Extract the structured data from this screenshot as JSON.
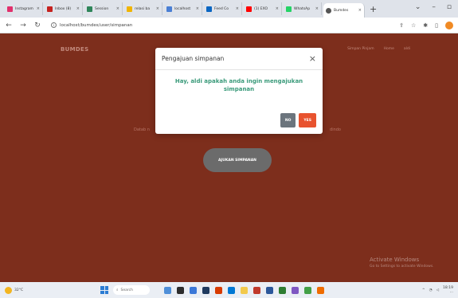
{
  "browser": {
    "tabs": [
      {
        "label": "Instagram",
        "color": "#e1306c"
      },
      {
        "label": "Inbox (8)",
        "color": "#c5221f"
      },
      {
        "label": "Session",
        "color": "#2f855a"
      },
      {
        "label": "relasi ba",
        "color": "#f0b400"
      },
      {
        "label": "localhost",
        "color": "#4a7fd4"
      },
      {
        "label": "Feed Co",
        "color": "#0a66c2"
      },
      {
        "label": "(1) EXO",
        "color": "#ff0000"
      },
      {
        "label": "WhatsAp",
        "color": "#25d366"
      },
      {
        "label": "Bumdes",
        "color": "#555555"
      }
    ],
    "url": "localhost/bumdes/user/simpanan"
  },
  "page": {
    "brand": "BUMDES",
    "nav": [
      "Simpan Pinjam",
      "Home",
      "aldi"
    ],
    "welcome_left": "Datab n",
    "welcome_right": "dindo",
    "cta_label": "AJUKAN SIMPANAN",
    "watermark_title": "Activate Windows",
    "watermark_sub": "Go to Settings to activate Windows."
  },
  "modal": {
    "title": "Pengajuan simpanan",
    "message": "Hay, aldi apakah anda ingin mengajukan simpanan",
    "no_label": "NO",
    "yes_label": "YES"
  },
  "taskbar": {
    "weather": "32°C",
    "search": "Search",
    "time": "18:19",
    "date": "..."
  },
  "colors": {
    "page_bg": "#7d2e1c",
    "modal_text": "#3a9a7a",
    "yes": "#e8532f",
    "no": "#6c757d"
  }
}
